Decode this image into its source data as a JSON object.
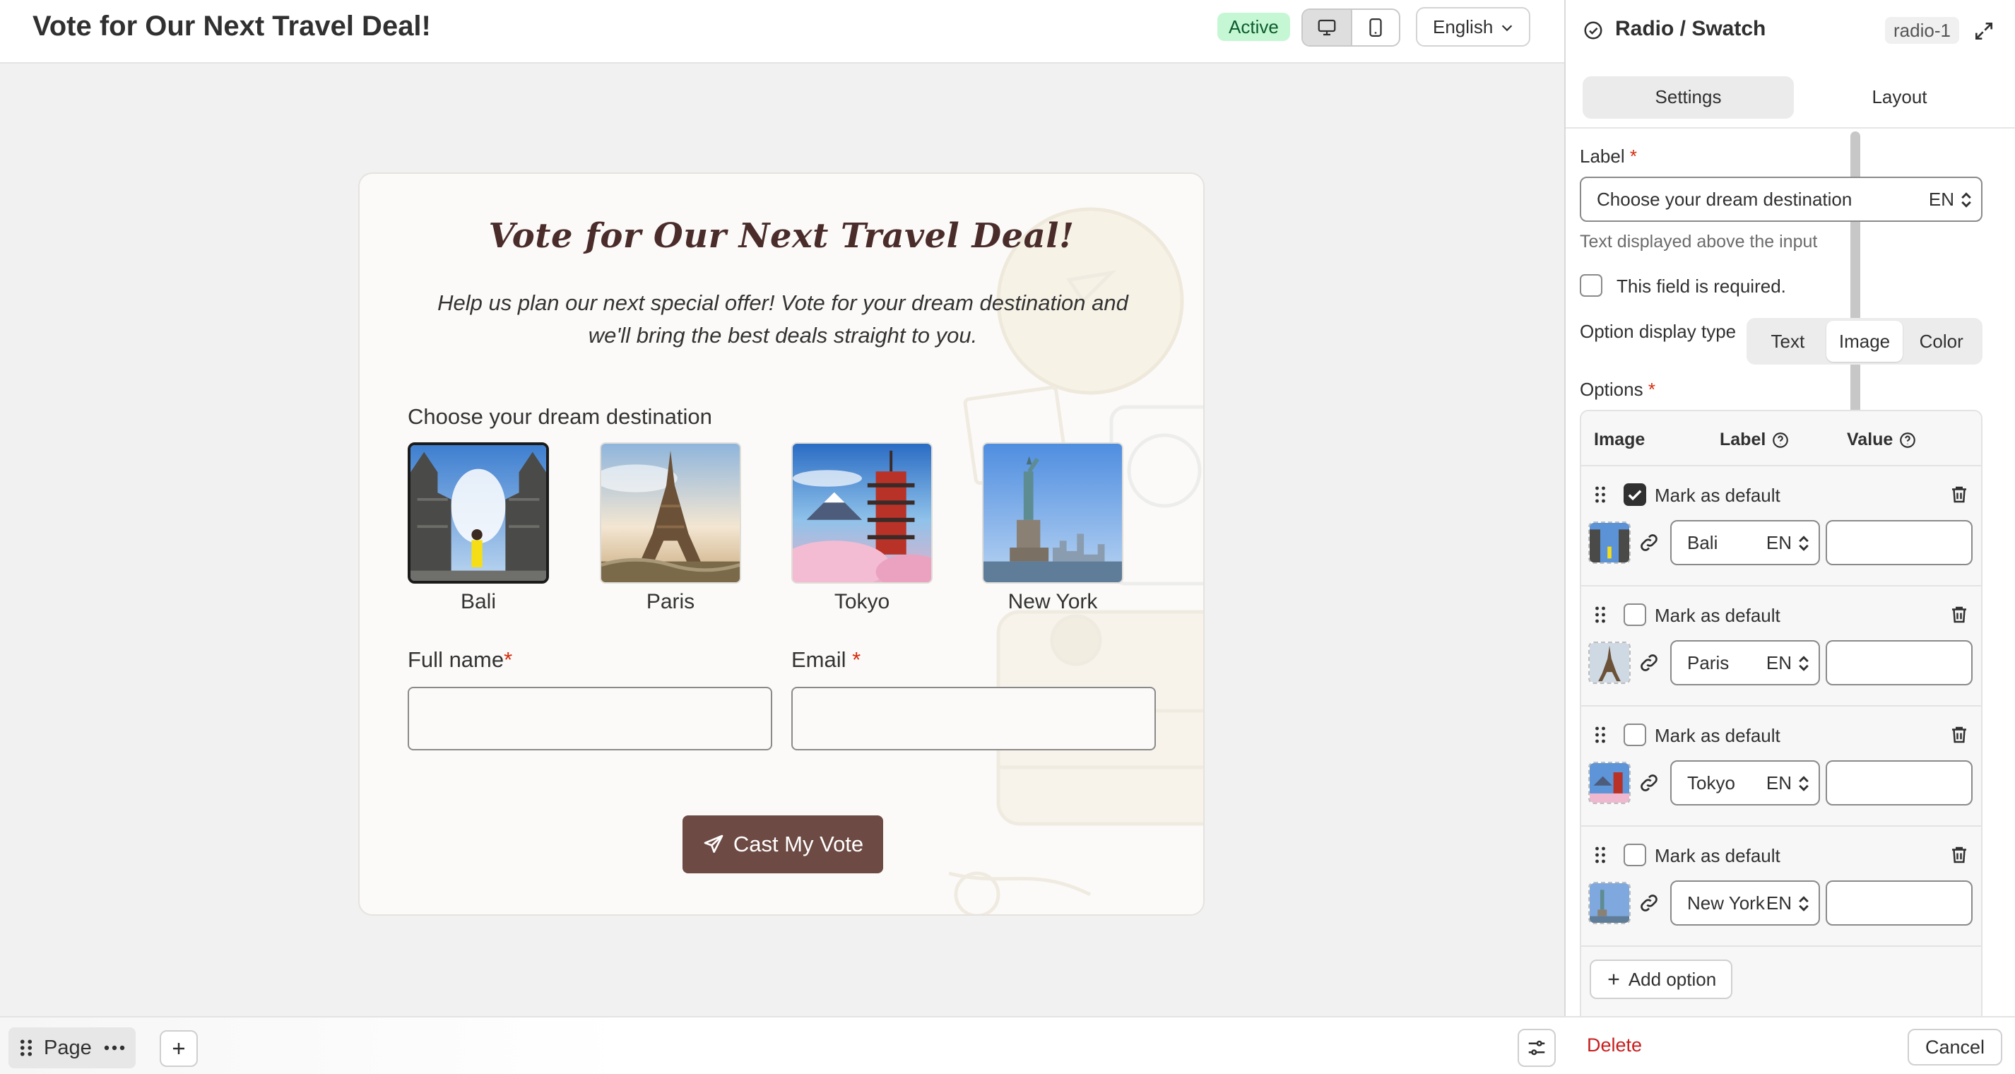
{
  "header": {
    "title": "Vote for Our Next Travel Deal!",
    "status": "Active",
    "language": "English",
    "icons": [
      "desktop-icon",
      "mobile-icon",
      "chevron-down-icon"
    ]
  },
  "form": {
    "heading": "Vote for Our Next Travel Deal!",
    "subheading": "Help us plan our next special offer! Vote for your dream destination and we'll bring the best deals straight to you.",
    "question_label": "Choose your dream destination",
    "destinations": [
      {
        "label": "Bali",
        "selected": true
      },
      {
        "label": "Paris",
        "selected": false
      },
      {
        "label": "Tokyo",
        "selected": false
      },
      {
        "label": "New York",
        "selected": false
      }
    ],
    "fullname_label": "Full name",
    "email_label": "Email",
    "required_mark": "*",
    "submit_label": "Cast My Vote",
    "button_color": "#6d4a44"
  },
  "bottom_bar": {
    "page_label": "Page",
    "icons": [
      "drag-handle-icon",
      "more-icon",
      "plus-icon",
      "sliders-icon"
    ]
  },
  "panel": {
    "title": "Radio / Swatch",
    "element_id": "radio-1",
    "tabs": [
      {
        "label": "Settings",
        "active": true
      },
      {
        "label": "Layout",
        "active": false
      }
    ],
    "label_title": "Label",
    "required_mark": "*",
    "label_value": "Choose your dream destination",
    "lang_code": "EN",
    "label_help": "Text displayed above the input",
    "required_checkbox_label": "This field is required.",
    "display_type_label": "Option display type",
    "display_types": [
      {
        "label": "Text",
        "active": false
      },
      {
        "label": "Image",
        "active": true
      },
      {
        "label": "Color",
        "active": false
      }
    ],
    "options_title": "Options",
    "columns": {
      "image": "Image",
      "label": "Label",
      "value": "Value"
    },
    "mark_default_label": "Mark as default",
    "options": [
      {
        "label": "Bali",
        "default": true,
        "value": ""
      },
      {
        "label": "Paris",
        "default": false,
        "value": ""
      },
      {
        "label": "Tokyo",
        "default": false,
        "value": ""
      },
      {
        "label": "New York",
        "default": false,
        "value": ""
      }
    ],
    "add_option_label": "Add option",
    "delete_label": "Delete",
    "cancel_label": "Cancel"
  }
}
